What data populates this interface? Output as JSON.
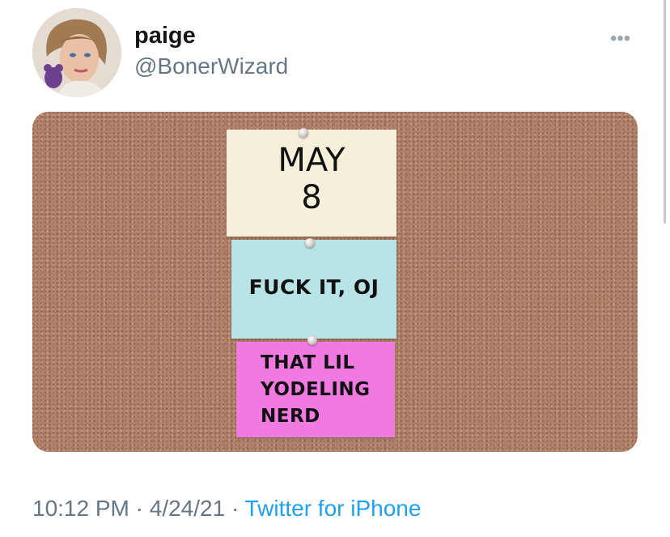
{
  "tweet": {
    "author": {
      "display_name": "paige",
      "handle": "@BonerWizard",
      "avatar_icon": "profile-portrait"
    },
    "more_label": "•••",
    "media": {
      "notes": [
        {
          "lines": [
            "MAY",
            "8"
          ],
          "color": "#f6efd9"
        },
        {
          "lines": [
            "FUCK IT, OJ"
          ],
          "color": "#b8e3e7"
        },
        {
          "lines": [
            "THAT LIL",
            "YODELING",
            "NERD"
          ],
          "color": "#f07ae2"
        }
      ],
      "background": "#b1826a"
    },
    "time": "10:12 PM",
    "separator": "·",
    "date": "4/24/21",
    "source": "Twitter for iPhone",
    "colors": {
      "link": "#1da1f2",
      "meta": "#657786",
      "text": "#14171a"
    }
  }
}
